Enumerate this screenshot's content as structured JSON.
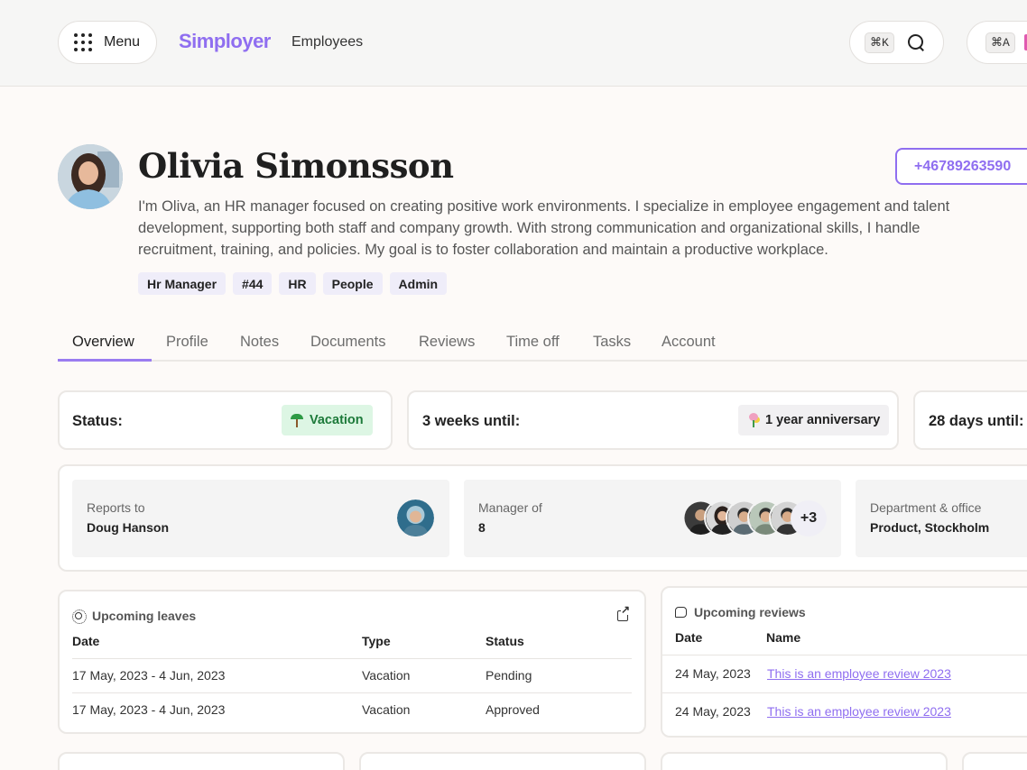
{
  "header": {
    "menu_label": "Menu",
    "brand": "Simployer",
    "breadcrumb": "Employees",
    "search_shortcut": "⌘K",
    "account_shortcut": "⌘A"
  },
  "profile": {
    "name": "Olivia Simonsson",
    "phone": "+46789263590",
    "bio": "I'm Oliva, an HR manager focused on creating positive work environments. I specialize in employee engagement and talent development, supporting both staff and company growth. With strong communication and organizational skills, I handle recruitment, training, and policies. My goal is to foster collaboration and maintain a productive workplace.",
    "tags": [
      "Hr Manager",
      "#44",
      "HR",
      "People",
      "Admin"
    ]
  },
  "tabs": [
    "Overview",
    "Profile",
    "Notes",
    "Documents",
    "Reviews",
    "Time off",
    "Tasks",
    "Account"
  ],
  "status_cards": {
    "status_label": "Status:",
    "status_value": "Vacation",
    "anniversary_label": "3 weeks until:",
    "anniversary_value": "1 year anniversary",
    "days_label": "28 days until:"
  },
  "relations": {
    "reports_label": "Reports to",
    "reports_value": "Doug Hanson",
    "manager_label": "Manager of",
    "manager_value": "8",
    "manager_more": "+3",
    "dept_label": "Department & office",
    "dept_value": "Product, Stockholm"
  },
  "leaves": {
    "title": "Upcoming leaves",
    "headers": [
      "Date",
      "Type",
      "Status"
    ],
    "rows": [
      [
        "17 May, 2023 - 4 Jun, 2023",
        "Vacation",
        "Pending"
      ],
      [
        "17 May, 2023 - 4 Jun, 2023",
        "Vacation",
        "Approved"
      ]
    ]
  },
  "reviews": {
    "title": "Upcoming reviews",
    "headers": [
      "Date",
      "Name"
    ],
    "rows": [
      [
        "24 May, 2023",
        "This is an employee review 2023"
      ],
      [
        "24 May, 2023",
        "This is an employee review 2023"
      ]
    ]
  },
  "colors": {
    "brand": "#8f6ef0",
    "vacation_bg": "#ddf6e4",
    "vacation_text": "#1d7a3a"
  }
}
